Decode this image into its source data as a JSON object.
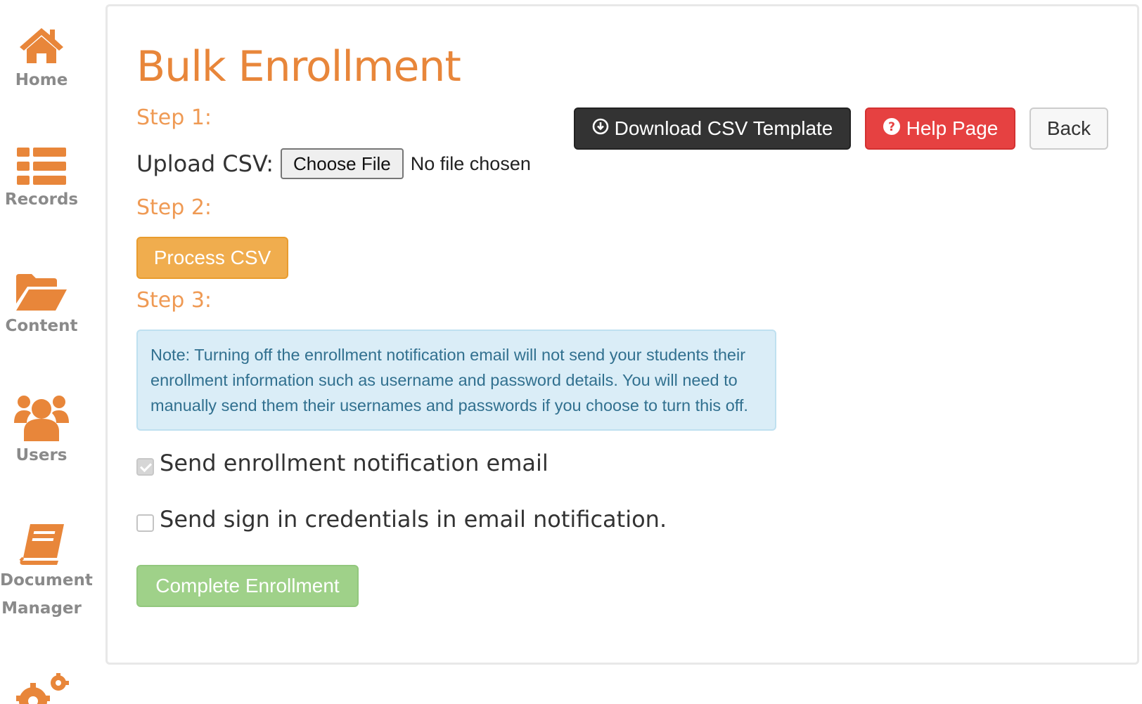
{
  "sidebar": {
    "items": [
      {
        "label": "Home",
        "icon": "home-icon"
      },
      {
        "label": "Records",
        "icon": "list-icon"
      },
      {
        "label": "Content",
        "icon": "folder-open-icon"
      },
      {
        "label": "Users",
        "icon": "users-icon"
      },
      {
        "label_line1": "Document",
        "label_line2": "Manager",
        "icon": "book-icon"
      },
      {
        "icon": "gears-icon"
      }
    ],
    "icon_color": "#e8863a",
    "label_color": "#8a8a8a"
  },
  "main": {
    "title": "Bulk Enrollment",
    "step1": {
      "label": "Step 1:",
      "upload_label": "Upload CSV:",
      "file_button": "Choose File",
      "file_status": "No file chosen"
    },
    "toolbar": {
      "download_label": "Download CSV Template",
      "download_icon": "download-circle-icon",
      "help_label": "Help Page",
      "help_icon": "question-circle-icon",
      "back_label": "Back"
    },
    "step2": {
      "label": "Step 2:",
      "process_label": "Process CSV"
    },
    "step3": {
      "label": "Step 3:",
      "note": "Note: Turning off the enrollment notification email will not send your students their enrollment information such as username and password details. You will need to manually send them their usernames and passwords if you choose to turn this off.",
      "options": [
        {
          "label": "Send enrollment notification email",
          "checked": true,
          "disabled": true
        },
        {
          "label": "Send sign in credentials in email notification.",
          "checked": false,
          "disabled": false
        }
      ],
      "complete_label": "Complete Enrollment"
    }
  },
  "colors": {
    "accent": "#e8863a",
    "dark_button": "#333333",
    "help_button": "#e64141",
    "process_button": "#f0ad4e",
    "complete_button": "#9fd189",
    "note_background": "#daedf7",
    "note_text": "#31708f"
  }
}
